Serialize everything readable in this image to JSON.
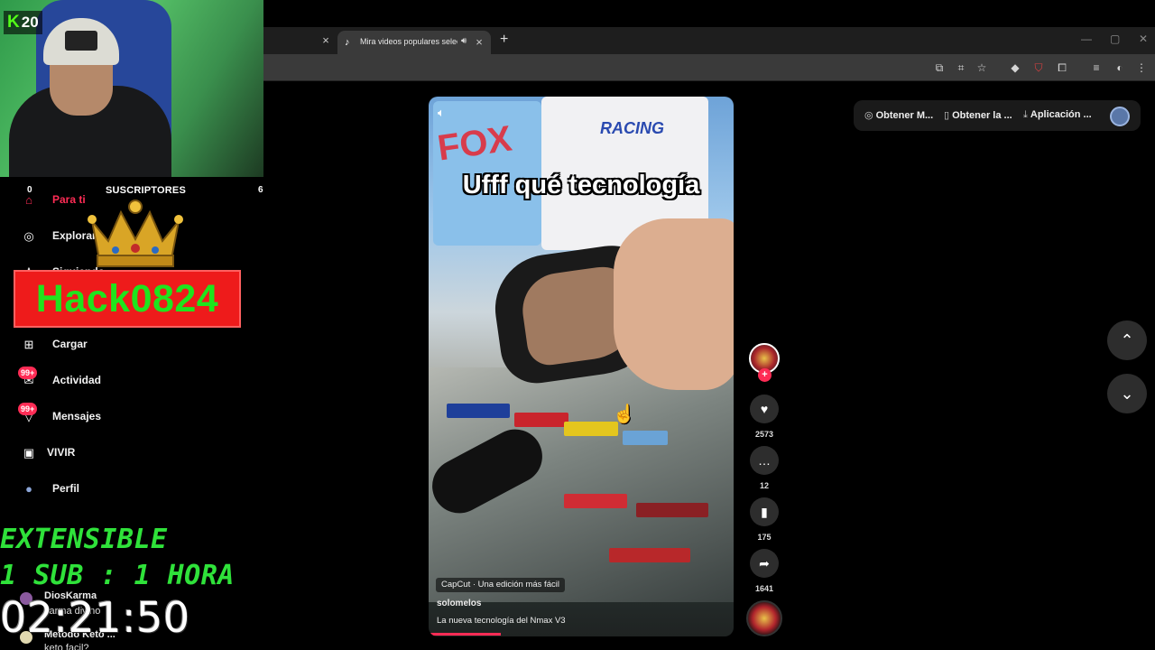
{
  "browser": {
    "active_tab_title": "Mira videos populares selec",
    "new_tab_symbol": "+",
    "close_symbol": "×",
    "window": {
      "minimize": "—",
      "maximize": "▢",
      "close": "✕"
    }
  },
  "tiktok": {
    "top_actions": [
      {
        "icon": "◎",
        "label": "Obtener M..."
      },
      {
        "icon": "▯",
        "label": "Obtener la ..."
      },
      {
        "icon": "⤓",
        "label": "Aplicación ..."
      }
    ],
    "video": {
      "caption_overlay": "Ufff qué tecnología",
      "shirt_print_1": "FOX",
      "shirt_print_2": "RACING",
      "effect_tag": "CapCut · Una edición más fácil",
      "author": "solomelos",
      "description": "La nueva tecnología del Nmax V3"
    },
    "rail": {
      "likes": "2573",
      "comments": "12",
      "saves": "175",
      "shares": "1641",
      "follow_symbol": "+"
    },
    "nav": {
      "up": "⌃",
      "down": "⌄"
    }
  },
  "sidebar": {
    "items": [
      {
        "label": "Para ti",
        "icon": "⌂"
      },
      {
        "label": "Explorar",
        "icon": "◎"
      },
      {
        "label": "Siguiendo",
        "icon": "♙"
      },
      {
        "label": "Cargar",
        "icon": "⊞"
      },
      {
        "label": "Actividad",
        "icon": "✉",
        "badge": "99+"
      },
      {
        "label": "Mensajes",
        "icon": "▽",
        "badge": "99+"
      },
      {
        "label": "VIVIR",
        "icon": "▣"
      },
      {
        "label": "Perfil",
        "icon": "●"
      }
    ]
  },
  "stream": {
    "kick_logo": "K",
    "kick_count": "20",
    "subscribers_title": "SUSCRIPTORES",
    "sub_left": "0",
    "sub_right": "6",
    "banner_name": "Hack0824",
    "promo_line1": "EXTENSIBLE",
    "promo_line2": "1 SUB : 1 HORA",
    "timer": "02:21:50",
    "chat": [
      {
        "name": "DiosKarma",
        "message": "karma divino"
      },
      {
        "name": "Metodo Keto ...",
        "message": "keto facil?"
      }
    ]
  },
  "colors": {
    "tiktok_red": "#fe2c55",
    "kick_green": "#53fc18",
    "banner_red": "#ee1b1b",
    "promo_green": "#2fe23a"
  }
}
